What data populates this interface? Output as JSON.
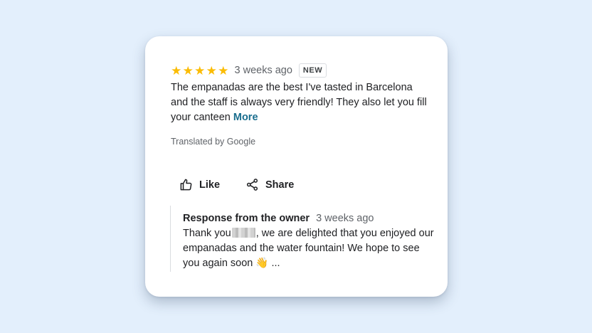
{
  "review": {
    "rating": 5,
    "stars": [
      "★",
      "★",
      "★",
      "★",
      "★"
    ],
    "date": "3 weeks ago",
    "badge": "NEW",
    "text": "The empanadas are the best I've tasted in Barcelona and the staff is always very friendly! They also let you fill your canteen",
    "more_label": "More",
    "translated_label": "Translated by Google"
  },
  "actions": {
    "like_label": "Like",
    "share_label": "Share"
  },
  "owner_response": {
    "title": "Response from the owner",
    "date": "3 weeks ago",
    "text_before_name": "Thank you",
    "text_after_name": ", we are delighted that you enjoyed our empanadas and the water fountain! We hope to see you again soon 👋 ..."
  },
  "colors": {
    "background": "#e3effc",
    "star": "#fbbc04",
    "more_link": "#1a6e8e"
  }
}
